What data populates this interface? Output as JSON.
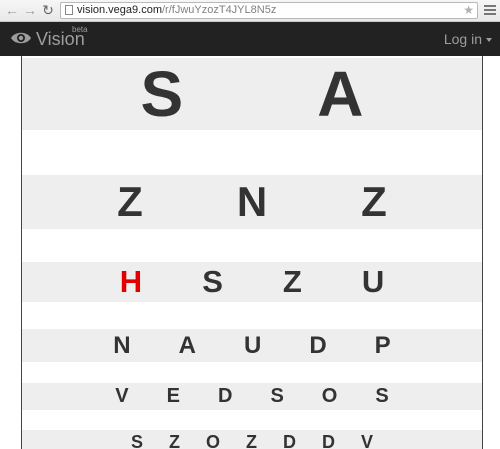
{
  "browser": {
    "url_host": "vision.vega9.com",
    "url_path": "/r/fJwuYzozT4JYL8N5z",
    "back_icon": "arrow-left",
    "forward_icon": "arrow-right",
    "reload_icon": "reload",
    "star_icon": "star"
  },
  "navbar": {
    "brand": "Vision",
    "beta": "beta",
    "login": "Log in",
    "background": "#222222",
    "text_color": "#9d9d9d"
  },
  "eye_chart": {
    "letter_color": "#333333",
    "highlight_color": "#e00000",
    "row_shade": "#eeeeee",
    "rows": [
      {
        "letters": [
          "S",
          "A"
        ]
      },
      {
        "letters": [
          "Z",
          "N",
          "Z"
        ]
      },
      {
        "letters": [
          "H",
          "S",
          "Z",
          "U"
        ],
        "highlighted_index": 0
      },
      {
        "letters": [
          "N",
          "A",
          "U",
          "D",
          "P"
        ]
      },
      {
        "letters": [
          "V",
          "E",
          "D",
          "S",
          "O",
          "S"
        ]
      },
      {
        "letters": [
          "S",
          "Z",
          "O",
          "Z",
          "D",
          "D",
          "V"
        ]
      }
    ]
  }
}
